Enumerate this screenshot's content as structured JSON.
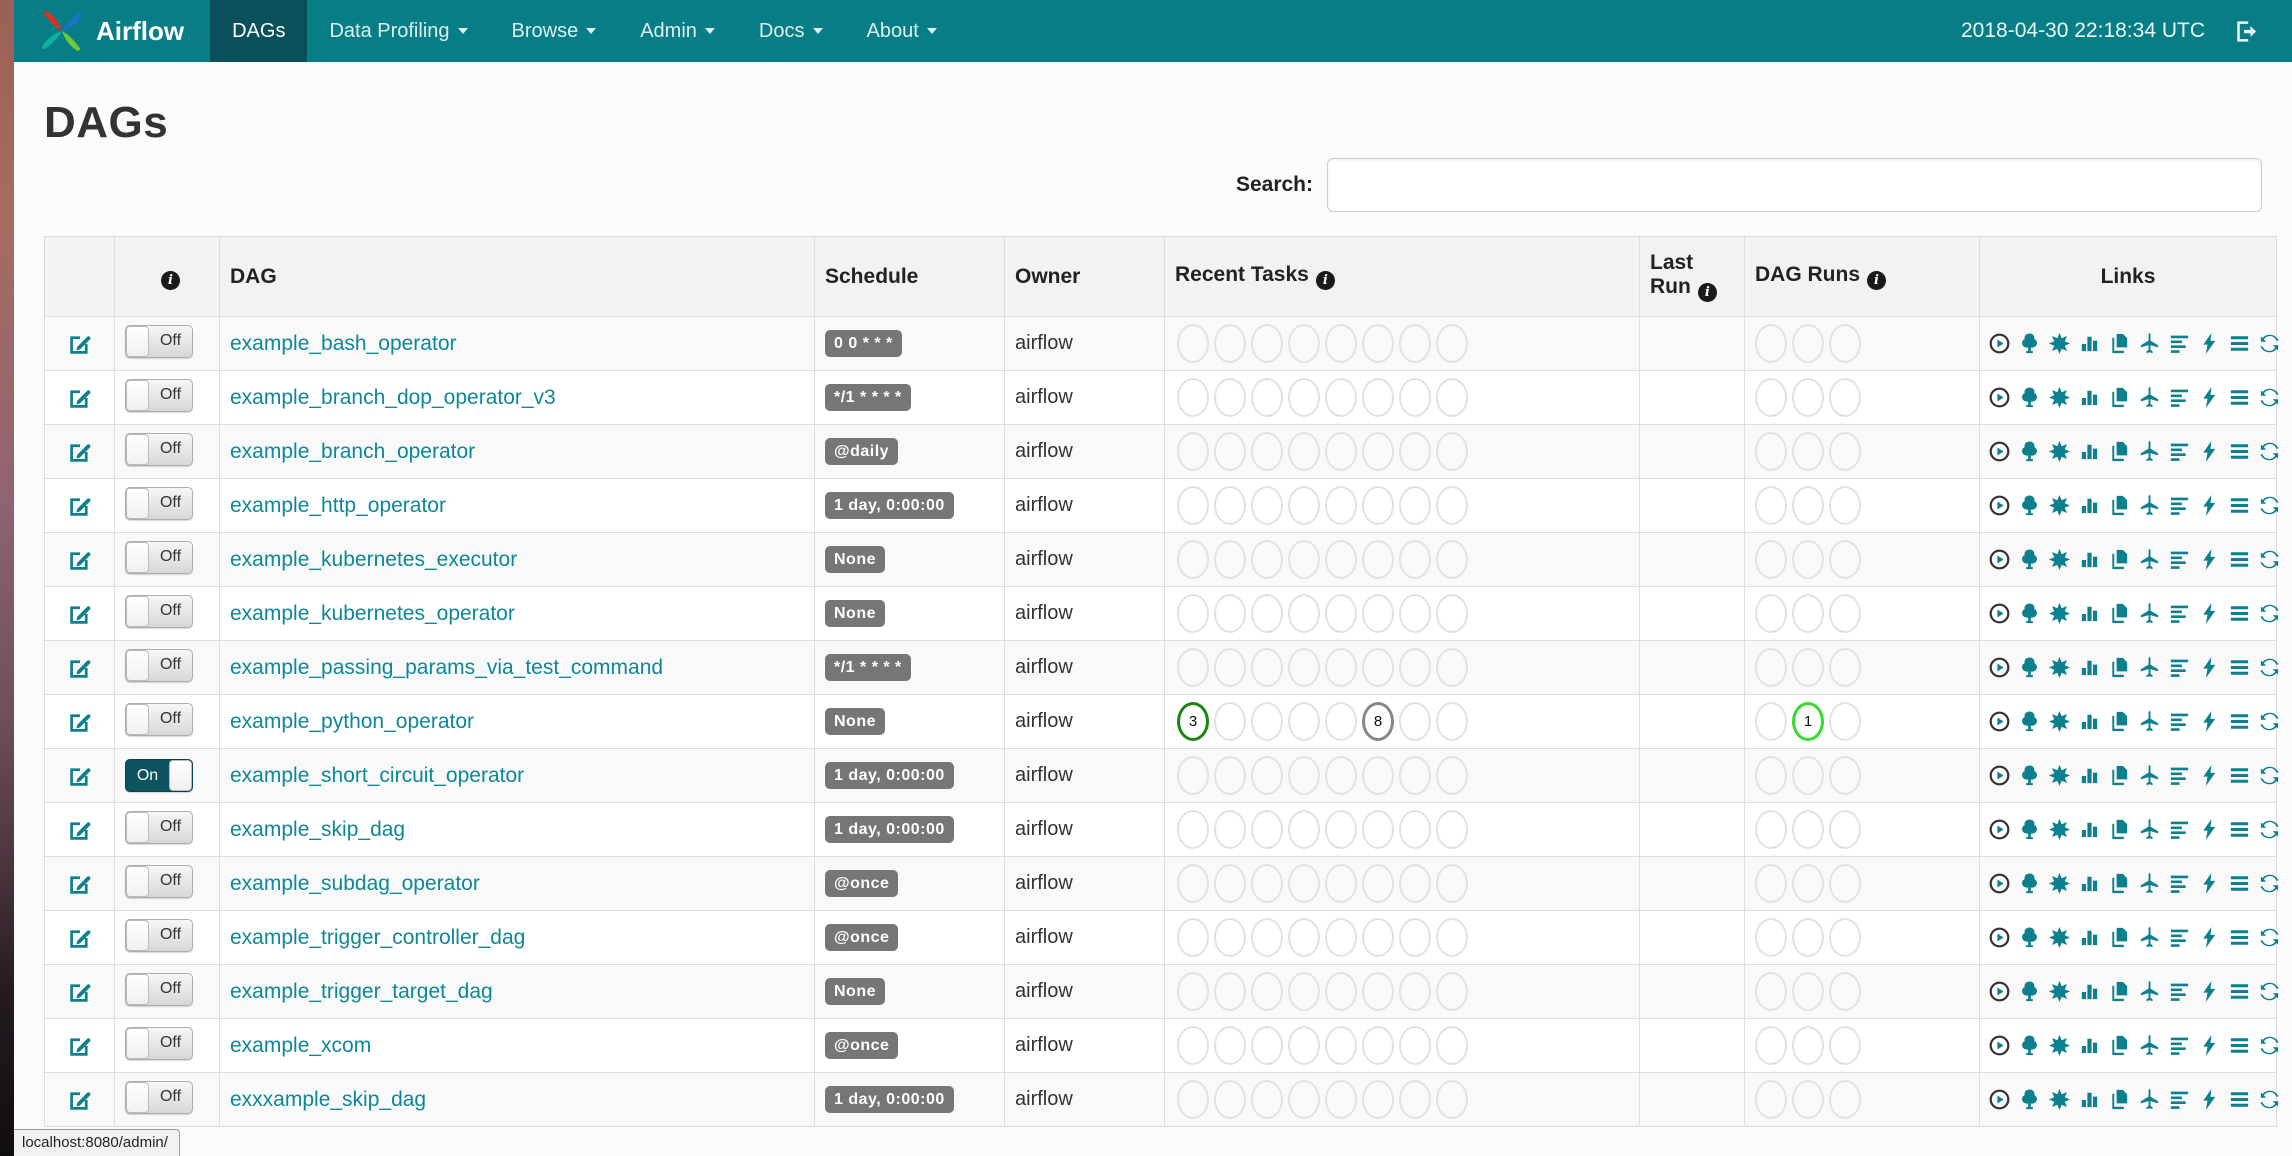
{
  "colors": {
    "navbar": "#077E85",
    "navbar_active": "#09505A",
    "link_teal": "#0E8798",
    "icon_teal": "#0E808D",
    "badge_gray": "#767676",
    "toggle_on": "#0D5360",
    "circle_success_green": "#1C8510",
    "circle_running_lime": "#35DB2E",
    "circle_gray": "#878787"
  },
  "navbar": {
    "brand": "Airflow",
    "items": [
      {
        "label": "DAGs",
        "active": true,
        "caret": false
      },
      {
        "label": "Data Profiling",
        "active": false,
        "caret": true
      },
      {
        "label": "Browse",
        "active": false,
        "caret": true
      },
      {
        "label": "Admin",
        "active": false,
        "caret": true
      },
      {
        "label": "Docs",
        "active": false,
        "caret": true
      },
      {
        "label": "About",
        "active": false,
        "caret": true
      }
    ],
    "clock": "2018-04-30 22:18:34 UTC"
  },
  "page": {
    "title": "DAGs",
    "search_label": "Search:",
    "search_value": "",
    "status_bar": "localhost:8080/admin/"
  },
  "table": {
    "columns": [
      {
        "label": "",
        "info": false
      },
      {
        "label": "",
        "info": true
      },
      {
        "label": "DAG",
        "info": false
      },
      {
        "label": "Schedule",
        "info": false
      },
      {
        "label": "Owner",
        "info": false
      },
      {
        "label": "Recent Tasks",
        "info": true
      },
      {
        "label": "Last Run",
        "info": true
      },
      {
        "label": "DAG Runs",
        "info": true
      },
      {
        "label": "Links",
        "info": false
      }
    ],
    "recent_tasks_slots": 8,
    "dag_runs_slots": 3,
    "links_icons": [
      "trigger-dag",
      "tree-view",
      "graph-view",
      "task-duration",
      "task-tries",
      "landing-times",
      "gantt",
      "code-view",
      "logs",
      "refresh"
    ],
    "rows": [
      {
        "dag": "example_bash_operator",
        "toggle": "Off",
        "schedule": "0 0 * * *",
        "owner": "airflow",
        "last_run": "",
        "recent_tasks": {},
        "dag_runs": {}
      },
      {
        "dag": "example_branch_dop_operator_v3",
        "toggle": "Off",
        "schedule": "*/1 * * * *",
        "owner": "airflow",
        "last_run": "",
        "recent_tasks": {},
        "dag_runs": {}
      },
      {
        "dag": "example_branch_operator",
        "toggle": "Off",
        "schedule": "@daily",
        "owner": "airflow",
        "last_run": "",
        "recent_tasks": {},
        "dag_runs": {}
      },
      {
        "dag": "example_http_operator",
        "toggle": "Off",
        "schedule": "1 day, 0:00:00",
        "owner": "airflow",
        "last_run": "",
        "recent_tasks": {},
        "dag_runs": {}
      },
      {
        "dag": "example_kubernetes_executor",
        "toggle": "Off",
        "schedule": "None",
        "owner": "airflow",
        "last_run": "",
        "recent_tasks": {},
        "dag_runs": {}
      },
      {
        "dag": "example_kubernetes_operator",
        "toggle": "Off",
        "schedule": "None",
        "owner": "airflow",
        "last_run": "",
        "recent_tasks": {},
        "dag_runs": {}
      },
      {
        "dag": "example_passing_params_via_test_command",
        "toggle": "Off",
        "schedule": "*/1 * * * *",
        "owner": "airflow",
        "last_run": "",
        "recent_tasks": {},
        "dag_runs": {}
      },
      {
        "dag": "example_python_operator",
        "toggle": "Off",
        "schedule": "None",
        "owner": "airflow",
        "last_run": "",
        "recent_tasks": {
          "1": {
            "label": "3",
            "color": "#1C8510"
          },
          "6": {
            "label": "8",
            "color": "#878787"
          }
        },
        "dag_runs": {
          "2": {
            "label": "1",
            "color": "#35DB2E"
          }
        }
      },
      {
        "dag": "example_short_circuit_operator",
        "toggle": "On",
        "schedule": "1 day, 0:00:00",
        "owner": "airflow",
        "last_run": "",
        "recent_tasks": {},
        "dag_runs": {}
      },
      {
        "dag": "example_skip_dag",
        "toggle": "Off",
        "schedule": "1 day, 0:00:00",
        "owner": "airflow",
        "last_run": "",
        "recent_tasks": {},
        "dag_runs": {}
      },
      {
        "dag": "example_subdag_operator",
        "toggle": "Off",
        "schedule": "@once",
        "owner": "airflow",
        "last_run": "",
        "recent_tasks": {},
        "dag_runs": {}
      },
      {
        "dag": "example_trigger_controller_dag",
        "toggle": "Off",
        "schedule": "@once",
        "owner": "airflow",
        "last_run": "",
        "recent_tasks": {},
        "dag_runs": {}
      },
      {
        "dag": "example_trigger_target_dag",
        "toggle": "Off",
        "schedule": "None",
        "owner": "airflow",
        "last_run": "",
        "recent_tasks": {},
        "dag_runs": {}
      },
      {
        "dag": "example_xcom",
        "toggle": "Off",
        "schedule": "@once",
        "owner": "airflow",
        "last_run": "",
        "recent_tasks": {},
        "dag_runs": {}
      },
      {
        "dag": "exxxample_skip_dag",
        "toggle": "Off",
        "schedule": "1 day, 0:00:00",
        "owner": "airflow",
        "last_run": "",
        "recent_tasks": {},
        "dag_runs": {}
      }
    ]
  }
}
